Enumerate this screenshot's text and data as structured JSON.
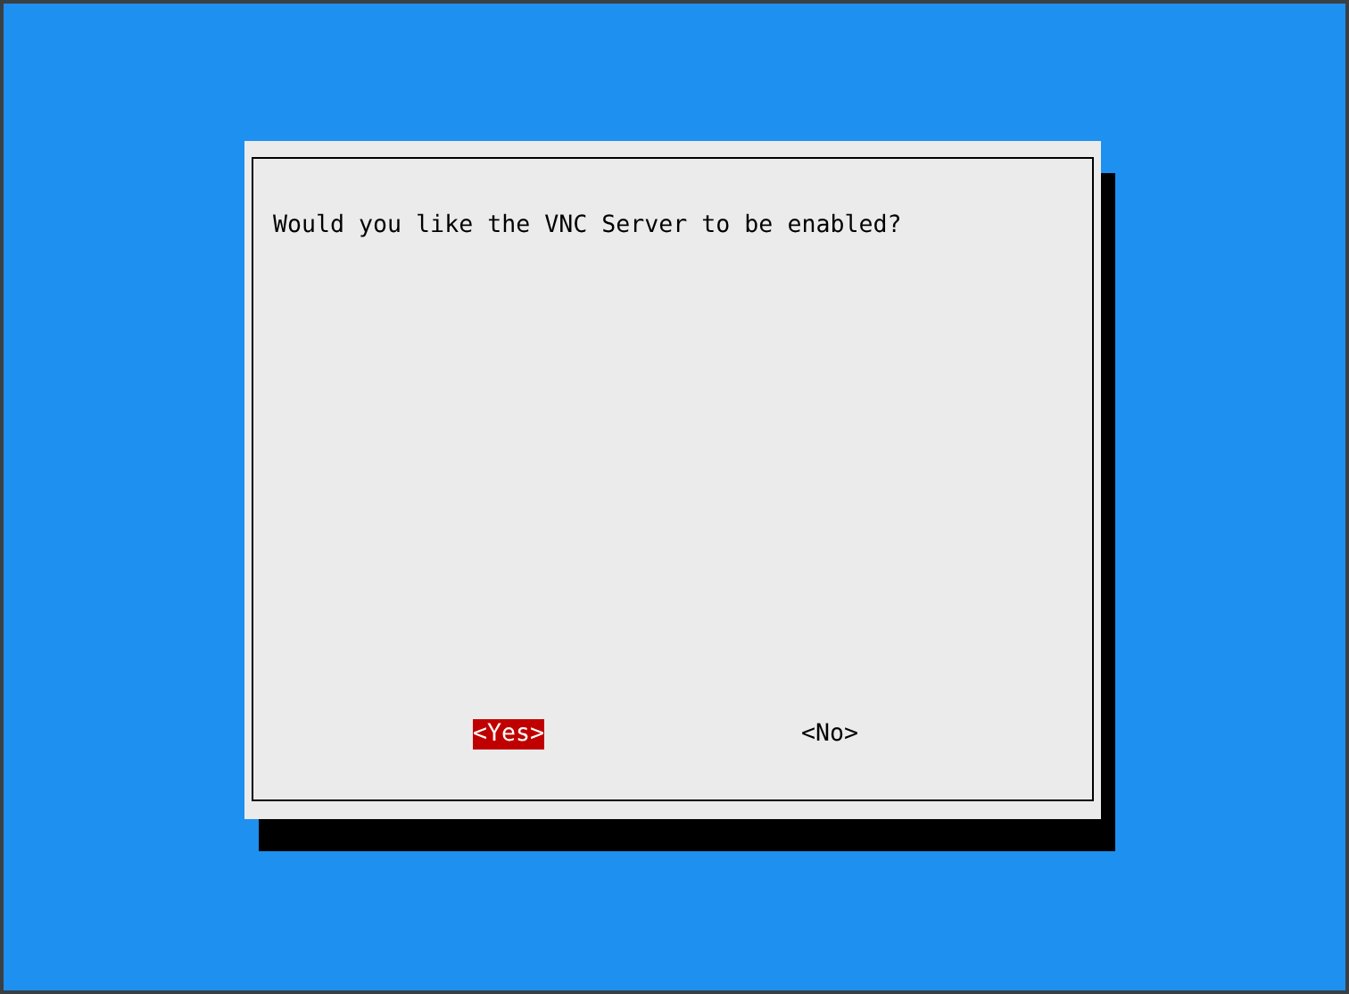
{
  "dialog": {
    "message": "Would you like the VNC Server to be enabled?",
    "buttons": [
      {
        "label": "<Yes>",
        "selected": true
      },
      {
        "label": "<No>",
        "selected": false
      }
    ]
  }
}
